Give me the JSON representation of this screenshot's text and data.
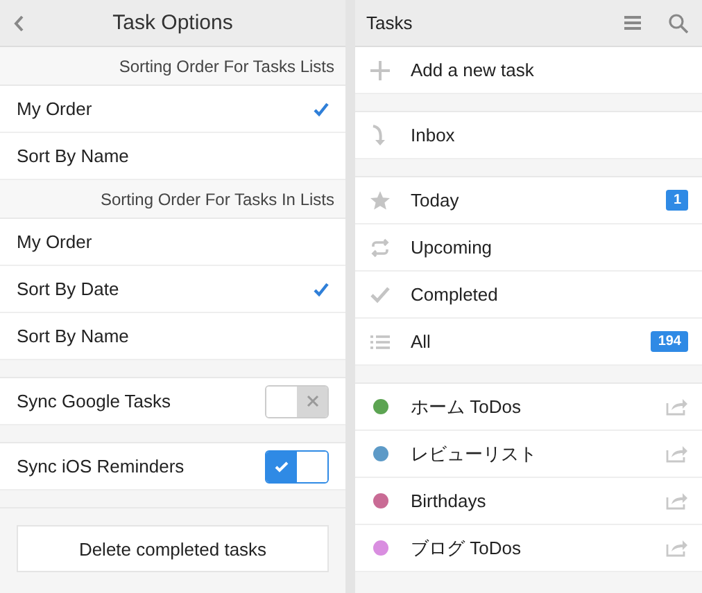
{
  "options_panel": {
    "title": "Task Options",
    "rows": [
      {
        "kind": "header",
        "label": "Sorting Order For Tasks Lists"
      },
      {
        "kind": "option",
        "label": "My Order",
        "checked": true
      },
      {
        "kind": "option",
        "label": "Sort By Name",
        "checked": false
      },
      {
        "kind": "header",
        "label": "Sorting Order For Tasks In Lists"
      },
      {
        "kind": "option",
        "label": "My Order",
        "checked": false
      },
      {
        "kind": "option",
        "label": "Sort By Date",
        "checked": true
      },
      {
        "kind": "option",
        "label": "Sort By Name",
        "checked": false
      },
      {
        "kind": "toggle",
        "label": "Sync Google Tasks",
        "on": false
      },
      {
        "kind": "toggle",
        "label": "Sync iOS Reminders",
        "on": true
      }
    ],
    "button": "Delete completed tasks"
  },
  "tasks_panel": {
    "title": "Tasks",
    "add_label": "Add a new task",
    "inbox": "Inbox",
    "smart_lists": [
      {
        "label": "Today",
        "badge": "1"
      },
      {
        "label": "Upcoming"
      },
      {
        "label": "Completed"
      },
      {
        "label": "All",
        "badge": "194"
      }
    ],
    "lists": [
      {
        "label": "ホーム ToDos",
        "color": "#5ca452"
      },
      {
        "label": "レビューリスト",
        "color": "#5d9ac7"
      },
      {
        "label": "Birthdays",
        "color": "#c96b95"
      },
      {
        "label": "ブログ ToDos",
        "color": "#d98ee0"
      }
    ]
  }
}
